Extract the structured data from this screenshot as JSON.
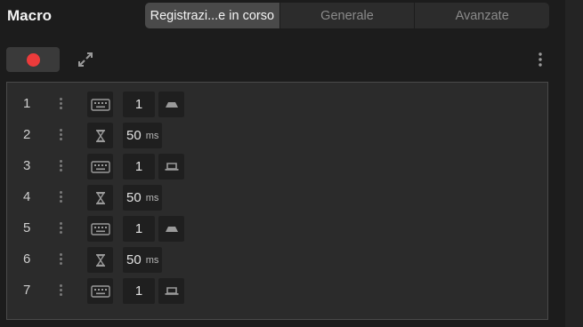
{
  "header": {
    "title": "Macro",
    "tabs": [
      {
        "label": "Registrazi...e in corso",
        "active": true
      },
      {
        "label": "Generale",
        "active": false
      },
      {
        "label": "Avanzate",
        "active": false
      }
    ]
  },
  "toolbar": {
    "record_icon": "record-dot",
    "expand_icon": "expand-arrows",
    "more_icon": "vertical-ellipsis"
  },
  "colors": {
    "accent": "#ec3b3b",
    "panel": "#2b2b2b",
    "background": "#1c1c1c"
  },
  "rows": [
    {
      "index": "1",
      "type": "keyboard",
      "value": "1",
      "unit": "",
      "action": "key-down"
    },
    {
      "index": "2",
      "type": "delay",
      "value": "50",
      "unit": "ms",
      "action": ""
    },
    {
      "index": "3",
      "type": "keyboard",
      "value": "1",
      "unit": "",
      "action": "key-up"
    },
    {
      "index": "4",
      "type": "delay",
      "value": "50",
      "unit": "ms",
      "action": ""
    },
    {
      "index": "5",
      "type": "keyboard",
      "value": "1",
      "unit": "",
      "action": "key-down"
    },
    {
      "index": "6",
      "type": "delay",
      "value": "50",
      "unit": "ms",
      "action": ""
    },
    {
      "index": "7",
      "type": "keyboard",
      "value": "1",
      "unit": "",
      "action": "key-up"
    }
  ]
}
